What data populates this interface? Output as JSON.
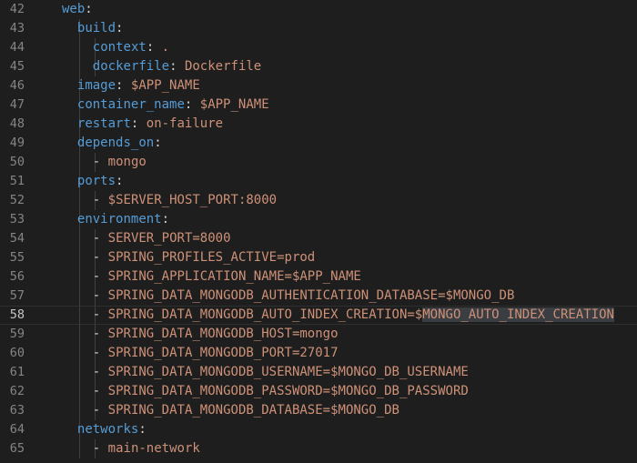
{
  "colors": {
    "background": "#1e1e1e",
    "line_number": "#858585",
    "line_number_active": "#c6c6c6",
    "key": "#569cd6",
    "value": "#ce9178",
    "punctuation": "#d4d4d4",
    "indent_guide": "#404040",
    "selection_highlight": "#3a3d41"
  },
  "active_line": 58,
  "lines": [
    {
      "num": "42",
      "indent": 2,
      "key": "web",
      "sep": ":",
      "val": ""
    },
    {
      "num": "43",
      "indent": 4,
      "key": "build",
      "sep": ":",
      "val": ""
    },
    {
      "num": "44",
      "indent": 6,
      "key": "context",
      "sep": ": ",
      "val": "."
    },
    {
      "num": "45",
      "indent": 6,
      "key": "dockerfile",
      "sep": ": ",
      "val": "Dockerfile"
    },
    {
      "num": "46",
      "indent": 4,
      "key": "image",
      "sep": ": ",
      "val": "$APP_NAME"
    },
    {
      "num": "47",
      "indent": 4,
      "key": "container_name",
      "sep": ": ",
      "val": "$APP_NAME"
    },
    {
      "num": "48",
      "indent": 4,
      "key": "restart",
      "sep": ": ",
      "val": "on-failure"
    },
    {
      "num": "49",
      "indent": 4,
      "key": "depends_on",
      "sep": ":",
      "val": ""
    },
    {
      "num": "50",
      "indent": 6,
      "key": "",
      "sep": "- ",
      "val": "mongo"
    },
    {
      "num": "51",
      "indent": 4,
      "key": "ports",
      "sep": ":",
      "val": ""
    },
    {
      "num": "52",
      "indent": 6,
      "key": "",
      "sep": "- ",
      "val": "$SERVER_HOST_PORT:8000"
    },
    {
      "num": "53",
      "indent": 4,
      "key": "environment",
      "sep": ":",
      "val": ""
    },
    {
      "num": "54",
      "indent": 6,
      "key": "",
      "sep": "- ",
      "val": "SERVER_PORT=8000"
    },
    {
      "num": "55",
      "indent": 6,
      "key": "",
      "sep": "- ",
      "val": "SPRING_PROFILES_ACTIVE=prod"
    },
    {
      "num": "56",
      "indent": 6,
      "key": "",
      "sep": "- ",
      "val": "SPRING_APPLICATION_NAME=$APP_NAME"
    },
    {
      "num": "57",
      "indent": 6,
      "key": "",
      "sep": "- ",
      "val": "SPRING_DATA_MONGODB_AUTHENTICATION_DATABASE=$MONGO_DB"
    },
    {
      "num": "58",
      "indent": 6,
      "key": "",
      "sep": "- ",
      "val": "SPRING_DATA_MONGODB_AUTO_INDEX_CREATION=$",
      "val_highlight": "MONGO_AUTO_INDEX_CREATION"
    },
    {
      "num": "59",
      "indent": 6,
      "key": "",
      "sep": "- ",
      "val": "SPRING_DATA_MONGODB_HOST=mongo"
    },
    {
      "num": "60",
      "indent": 6,
      "key": "",
      "sep": "- ",
      "val": "SPRING_DATA_MONGODB_PORT=27017"
    },
    {
      "num": "61",
      "indent": 6,
      "key": "",
      "sep": "- ",
      "val": "SPRING_DATA_MONGODB_USERNAME=$MONGO_DB_USERNAME"
    },
    {
      "num": "62",
      "indent": 6,
      "key": "",
      "sep": "- ",
      "val": "SPRING_DATA_MONGODB_PASSWORD=$MONGO_DB_PASSWORD"
    },
    {
      "num": "63",
      "indent": 6,
      "key": "",
      "sep": "- ",
      "val": "SPRING_DATA_MONGODB_DATABASE=$MONGO_DB"
    },
    {
      "num": "64",
      "indent": 4,
      "key": "networks",
      "sep": ":",
      "val": ""
    },
    {
      "num": "65",
      "indent": 6,
      "key": "",
      "sep": "- ",
      "val": "main-network"
    }
  ]
}
